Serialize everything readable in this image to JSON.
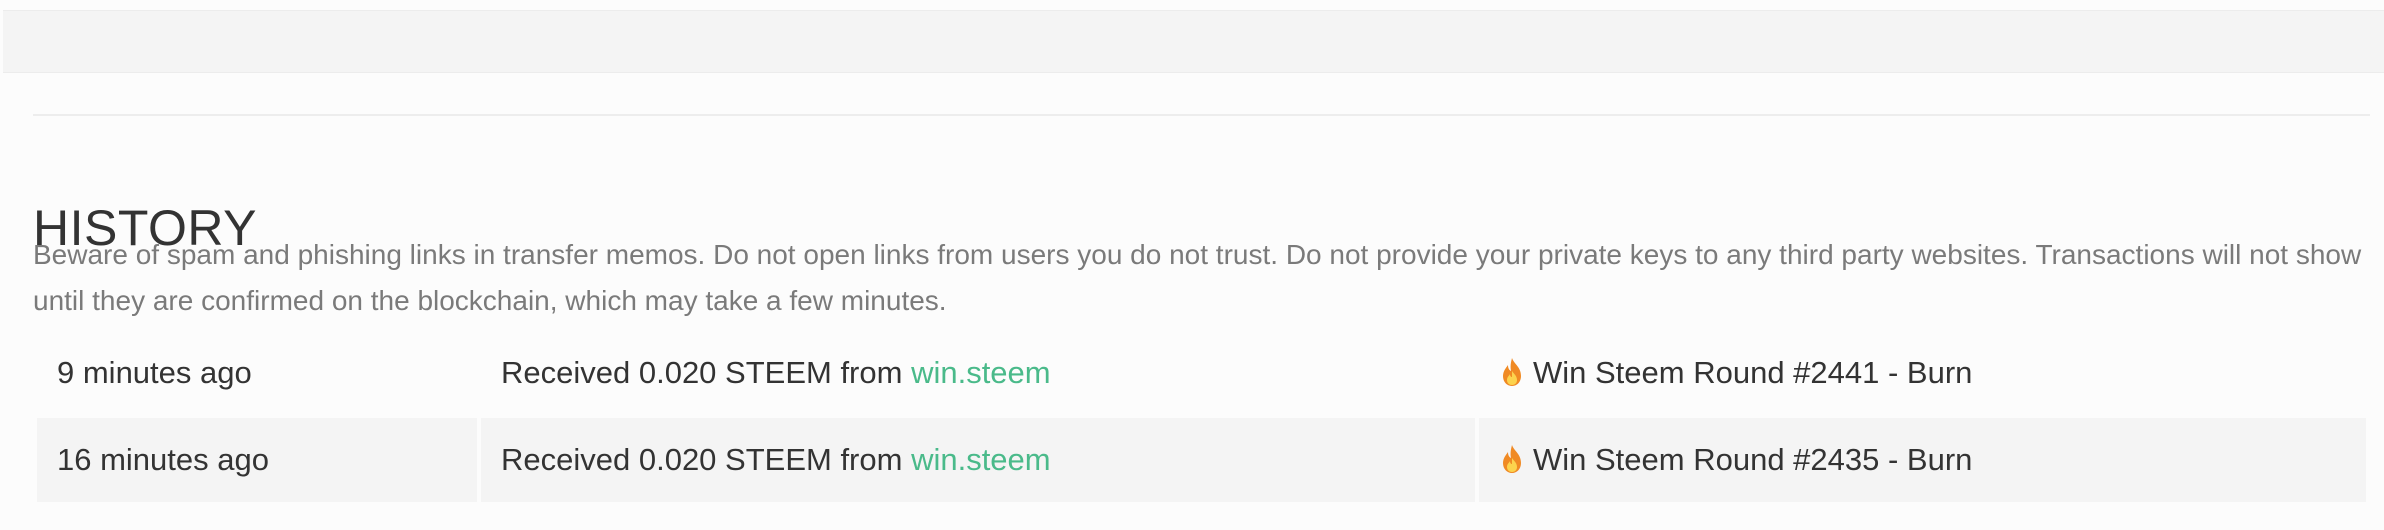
{
  "history": {
    "title": "HISTORY",
    "warning": "Beware of spam and phishing links in transfer memos. Do not open links from users you do not trust. Do not provide your private keys to any third party websites. Transactions will not show until they are confirmed on the blockchain, which may take a few minutes.",
    "rows": [
      {
        "time": "9 minutes ago",
        "action": "Received 0.020 STEEM from ",
        "user": "win.steem",
        "memo_icon": "flame-icon",
        "memo": "Win Steem Round #2441 - Burn"
      },
      {
        "time": "16 minutes ago",
        "action": "Received 0.020 STEEM from ",
        "user": "win.steem",
        "memo_icon": "flame-icon",
        "memo": "Win Steem Round #2435 - Burn"
      }
    ]
  },
  "colors": {
    "link": "#4aba8a",
    "alt_row": "#f4f4f4",
    "muted_text": "#7a7a7a"
  }
}
